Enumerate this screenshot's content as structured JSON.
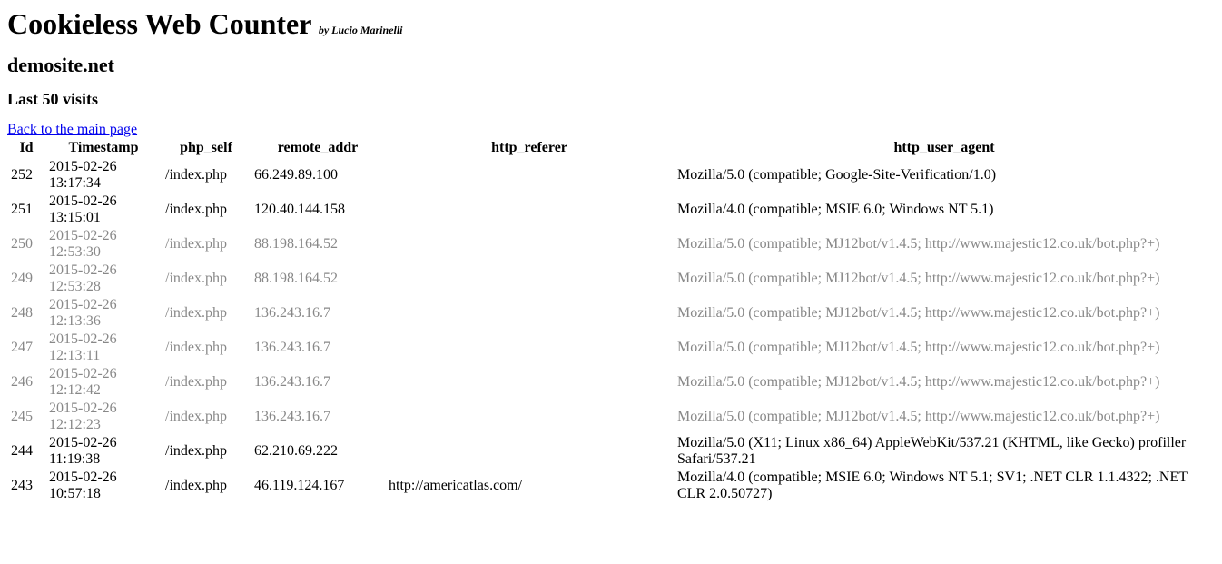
{
  "header": {
    "title": "Cookieless Web Counter",
    "byline": "by Lucio Marinelli"
  },
  "site": "demosite.net",
  "subtitle": "Last 50 visits",
  "backlink": "Back to the main page",
  "columns": {
    "id": "Id",
    "timestamp": "Timestamp",
    "php_self": "php_self",
    "remote_addr": "remote_addr",
    "http_referer": "http_referer",
    "http_user_agent": "http_user_agent"
  },
  "rows": [
    {
      "id": "252",
      "timestamp": "2015-02-26 13:17:34",
      "php_self": "/index.php",
      "remote_addr": "66.249.89.100",
      "http_referer": "",
      "http_user_agent": "Mozilla/5.0 (compatible; Google-Site-Verification/1.0)",
      "bot": false
    },
    {
      "id": "251",
      "timestamp": "2015-02-26 13:15:01",
      "php_self": "/index.php",
      "remote_addr": "120.40.144.158",
      "http_referer": "",
      "http_user_agent": "Mozilla/4.0 (compatible; MSIE 6.0; Windows NT 5.1)",
      "bot": false
    },
    {
      "id": "250",
      "timestamp": "2015-02-26 12:53:30",
      "php_self": "/index.php",
      "remote_addr": "88.198.164.52",
      "http_referer": "",
      "http_user_agent": "Mozilla/5.0 (compatible; MJ12bot/v1.4.5; http://www.majestic12.co.uk/bot.php?+)",
      "bot": true
    },
    {
      "id": "249",
      "timestamp": "2015-02-26 12:53:28",
      "php_self": "/index.php",
      "remote_addr": "88.198.164.52",
      "http_referer": "",
      "http_user_agent": "Mozilla/5.0 (compatible; MJ12bot/v1.4.5; http://www.majestic12.co.uk/bot.php?+)",
      "bot": true
    },
    {
      "id": "248",
      "timestamp": "2015-02-26 12:13:36",
      "php_self": "/index.php",
      "remote_addr": "136.243.16.7",
      "http_referer": "",
      "http_user_agent": "Mozilla/5.0 (compatible; MJ12bot/v1.4.5; http://www.majestic12.co.uk/bot.php?+)",
      "bot": true
    },
    {
      "id": "247",
      "timestamp": "2015-02-26 12:13:11",
      "php_self": "/index.php",
      "remote_addr": "136.243.16.7",
      "http_referer": "",
      "http_user_agent": "Mozilla/5.0 (compatible; MJ12bot/v1.4.5; http://www.majestic12.co.uk/bot.php?+)",
      "bot": true
    },
    {
      "id": "246",
      "timestamp": "2015-02-26 12:12:42",
      "php_self": "/index.php",
      "remote_addr": "136.243.16.7",
      "http_referer": "",
      "http_user_agent": "Mozilla/5.0 (compatible; MJ12bot/v1.4.5; http://www.majestic12.co.uk/bot.php?+)",
      "bot": true
    },
    {
      "id": "245",
      "timestamp": "2015-02-26 12:12:23",
      "php_self": "/index.php",
      "remote_addr": "136.243.16.7",
      "http_referer": "",
      "http_user_agent": "Mozilla/5.0 (compatible; MJ12bot/v1.4.5; http://www.majestic12.co.uk/bot.php?+)",
      "bot": true
    },
    {
      "id": "244",
      "timestamp": "2015-02-26 11:19:38",
      "php_self": "/index.php",
      "remote_addr": "62.210.69.222",
      "http_referer": "",
      "http_user_agent": "Mozilla/5.0 (X11; Linux x86_64) AppleWebKit/537.21 (KHTML, like Gecko) profiller Safari/537.21",
      "bot": false
    },
    {
      "id": "243",
      "timestamp": "2015-02-26 10:57:18",
      "php_self": "/index.php",
      "remote_addr": "46.119.124.167",
      "http_referer": "http://americatlas.com/",
      "http_user_agent": "Mozilla/4.0 (compatible; MSIE 6.0; Windows NT 5.1; SV1; .NET CLR 1.1.4322; .NET CLR 2.0.50727)",
      "bot": false
    }
  ]
}
